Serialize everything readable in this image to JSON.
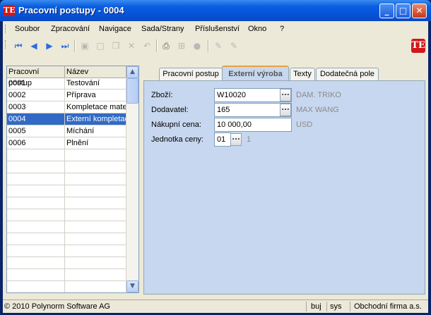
{
  "window": {
    "title": "Pracovní postupy - 0004",
    "app_icon_text": "TE",
    "minimize": "_",
    "maximize": "□",
    "close": "✕"
  },
  "menu": {
    "items": [
      "Soubor",
      "Zpracování",
      "Navigace",
      "Sada/Strany",
      "Příslušenství",
      "Okno",
      "?"
    ]
  },
  "toolbar": {
    "icons": [
      "first-record-icon",
      "previous-record-icon",
      "next-record-icon",
      "last-record-icon",
      "save-icon",
      "new-icon",
      "copy-icon",
      "delete-icon",
      "undo-icon",
      "print-icon",
      "tree-icon",
      "help-icon",
      "edit-icon",
      "edit-alt-icon"
    ],
    "logo_text": "TE"
  },
  "grid": {
    "columns": [
      "Pracovní postup",
      "Název"
    ],
    "rows": [
      [
        "0001",
        "Testování"
      ],
      [
        "0002",
        "Příprava"
      ],
      [
        "0003",
        "Kompletace mate"
      ],
      [
        "0004",
        "Externí kompletac"
      ],
      [
        "0005",
        "Míchání"
      ],
      [
        "0006",
        "Plnění"
      ]
    ],
    "selected_index": 3,
    "scroll_up": "▲",
    "scroll_down": "▼"
  },
  "tabs": [
    "Pracovní postup",
    "Externí výroba",
    "Texty",
    "Dodatečná pole"
  ],
  "active_tab": "Externí výroba",
  "form": {
    "goods_label": "Zboží:",
    "goods_value": "W10020",
    "goods_desc": "DAM. TRIKO",
    "supplier_label": "Dodavatel:",
    "supplier_value": "165",
    "supplier_desc": "MAX WANG",
    "price_label": "Nákupní cena:",
    "price_value": "10 000,00",
    "price_currency": "USD",
    "unit_label": "Jednotka ceny:",
    "unit_value": "01",
    "unit_desc": "1",
    "ellipsis": "..."
  },
  "status": {
    "copyright": "© 2010 Polynorm Software AG",
    "user": "buj",
    "system": "sys",
    "company": "Obchodní firma a.s."
  }
}
